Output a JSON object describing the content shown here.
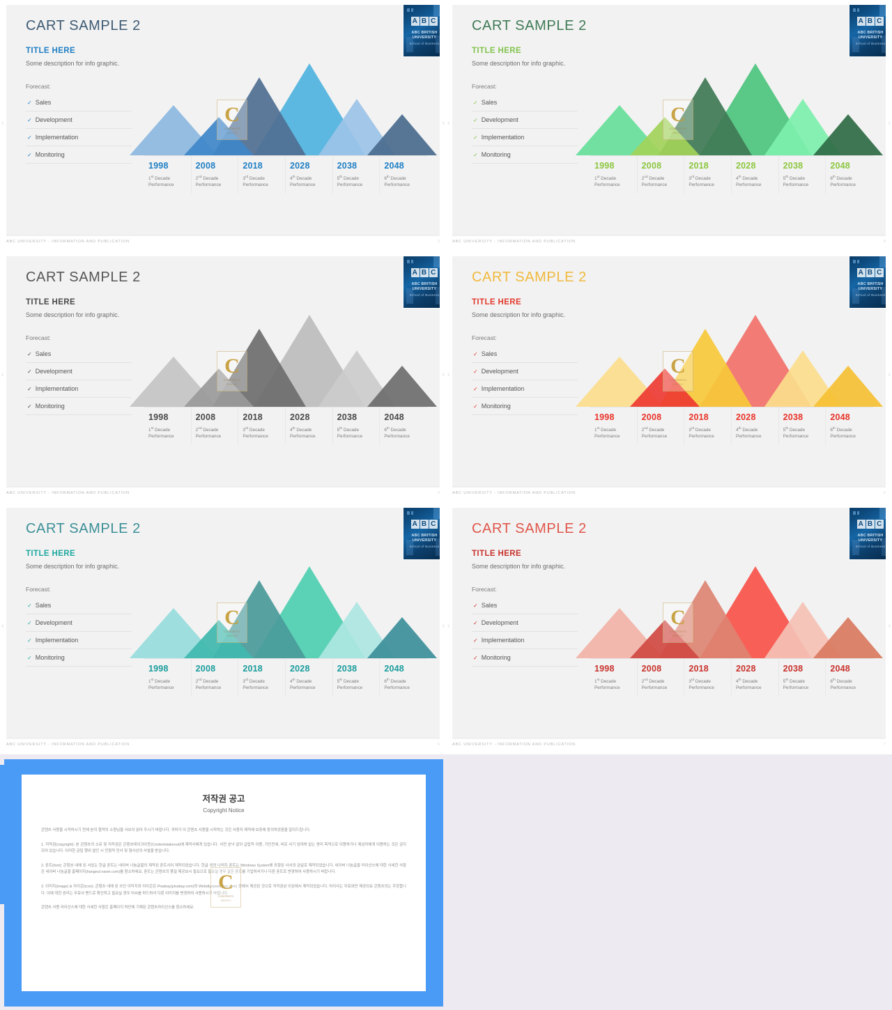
{
  "deck": {
    "slide_title": "CART SAMPLE 2",
    "info_title": "TITLE HERE",
    "info_desc": "Some description for info graphic.",
    "forecast_label": "Forecast:",
    "checklist": [
      "Sales",
      "Development",
      "Implementation",
      "Monitoring"
    ],
    "tick_glyph": "✓",
    "nav_prev": "‹",
    "nav_next": "›",
    "footer_text": "ABC UNIVERSITY - INFORMATION AND PUBLICATION"
  },
  "logo": {
    "abc_letters": [
      "A",
      "B",
      "C"
    ],
    "name_line1": "ABC BRITISH",
    "name_line2": "UNIVERSITY",
    "subtitle": "School of Business"
  },
  "watermark": {
    "letter": "C",
    "line1": "CONTENTS",
    "line2": "TAKEOUT"
  },
  "chart_data": {
    "type": "area",
    "title": "CART SAMPLE 2",
    "subtitle": "TITLE HERE",
    "xlabel": "",
    "ylabel": "",
    "grid": false,
    "legend": "none",
    "categories": [
      "1998",
      "2008",
      "2018",
      "2028",
      "2038",
      "2048"
    ],
    "tick_sublabels": [
      {
        "ordinal": "1",
        "suffix": "st",
        "text": "Decade Performance"
      },
      {
        "ordinal": "2",
        "suffix": "nd",
        "text": "Decade Performance"
      },
      {
        "ordinal": "3",
        "suffix": "rd",
        "text": "Decade Performance"
      },
      {
        "ordinal": "4",
        "suffix": "th",
        "text": "Decade Performance"
      },
      {
        "ordinal": "5",
        "suffix": "th",
        "text": "Decade Performance"
      },
      {
        "ordinal": "6",
        "suffix": "th",
        "text": "Decade Performance"
      }
    ],
    "values": [
      55,
      42,
      85,
      100,
      62,
      45
    ],
    "ylim": [
      0,
      100
    ],
    "note": "Six overlapping triangular peaks, relative peak heights as percent of plot height."
  },
  "peaks": [
    {
      "center_pct": 10,
      "half_width_pct": 15,
      "height_pct": 55,
      "z": 2
    },
    {
      "center_pct": 25.5,
      "half_width_pct": 12,
      "height_pct": 42,
      "z": 3
    },
    {
      "center_pct": 39,
      "half_width_pct": 16,
      "height_pct": 85,
      "z": 2
    },
    {
      "center_pct": 56,
      "half_width_pct": 19,
      "height_pct": 100,
      "z": 1
    },
    {
      "center_pct": 72,
      "half_width_pct": 13,
      "height_pct": 62,
      "z": 2
    },
    {
      "center_pct": 87.5,
      "half_width_pct": 12,
      "height_pct": 45,
      "z": 3
    }
  ],
  "slides": [
    {
      "page": "3",
      "theme": "blue",
      "title_color": "#3d5a73",
      "subtitle_color": "#1f7fc4",
      "year_color": "#1f7fc4",
      "check_color": "#555555",
      "peak_colors": [
        "#8cb8e0",
        "#3f87c9",
        "#4f6f92",
        "#4fb3de",
        "#9cc3e8",
        "#4a6b8e"
      ]
    },
    {
      "page": "8",
      "theme": "green",
      "title_color": "#3f7a55",
      "subtitle_color": "#82c44d",
      "year_color": "#8cc63f",
      "check_color": "#555555",
      "peak_colors": [
        "#66de9a",
        "#a2d25a",
        "#3f7a55",
        "#4dc47e",
        "#7df0ad",
        "#2f6b45"
      ]
    },
    {
      "page": "4",
      "theme": "gray",
      "title_color": "#555555",
      "subtitle_color": "#4a4a4a",
      "year_color": "#4a4a4a",
      "check_color": "#555555",
      "peak_colors": [
        "#c4c4c4",
        "#9a9a9a",
        "#6e6e6e",
        "#bdbdbd",
        "#cccccc",
        "#6e6e6e"
      ]
    },
    {
      "page": "5",
      "theme": "yellow",
      "title_color": "#f0b93c",
      "subtitle_color": "#e23b2e",
      "year_color": "#e8342a",
      "check_color": "#555555",
      "peak_colors": [
        "#fbdd8c",
        "#ee3b33",
        "#f7c93a",
        "#f2726a",
        "#fbdd8c",
        "#f5c033"
      ]
    },
    {
      "page": "6",
      "theme": "teal",
      "title_color": "#3b8f97",
      "subtitle_color": "#1fa8a0",
      "year_color": "#1a9c9c",
      "check_color": "#555555",
      "peak_colors": [
        "#97dcdc",
        "#3fb9ae",
        "#4a9a9a",
        "#4ecfb0",
        "#aee6e3",
        "#3d8f9a"
      ]
    },
    {
      "page": "7",
      "theme": "red",
      "title_color": "#e0564a",
      "subtitle_color": "#c8322c",
      "year_color": "#c8322c",
      "check_color": "#555555",
      "peak_colors": [
        "#f2b3a8",
        "#d04a42",
        "#dd8472",
        "#f8534a",
        "#f5c1b5",
        "#d9795f"
      ]
    }
  ],
  "copyright": {
    "title": "저작권 공고",
    "subtitle": "Copyright Notice",
    "paragraphs": [
      "콘텐츠 사용을 시작하시기 전에 본의 협약의 소원님을 사보이 읽어 주시기 바랍니다. 귀하가 이 콘텐츠 사용을 시작하는 것은 사용자 제약에 보증에 동의하셨음을 알려드립니다.",
      "1. 저작권(copyright): 본 콘텐츠의 소유 및 저작권은 콘텐츠테이크아웃(Contentstakeout)에 제작사에게 있습니다. 사전 승낙 없이 급립적 이용, 가인전세, 비로 사기 임대하 없는 영리 목적으로 이용하거나 제삼자에게 이용하는 것은 금지되어 있습니다. 이러한 금립 행위 발인 시 민형적 민사 및 형사상의 사벌을 받습니다.",
      "2. 폰트(font): 콘텐츠 내에 된 서있는 한글 폰트는 네이버 나눔글꼴의 제작된 폰트사이 제작되었습니다. 한글 외의 나머지 폰트는 Windows System에 포함된 사서의 금살로 제작되었습니다. 네이버 나눔글꼴 라이선스에 대한 사세한 사항은 네이버 나눔글꼴 홈페이지(hangeul.naver.com)를 참소하세요. 폰트는 콘텐츠의 품질 제공보시 필요으로 필요실 경우 같은 폰트를 기업하셔거나 다른 폰트로 변경하여 사용하시기 바랍니다.",
      "3. 이미지(image) & 아이콘(icon): 콘텐츠 내에 된 쓰인 이미지와 아이콘은 Pixabay(pixabay.com)와 Webdlys(webdlys.com) 중에서 제공된 것으로 저작권삼 이상에서 제작되었습니다. 아이사는 무료와만 제공되요 콘텐츠의는 주장합니다. 이에 대한 권리는 무료사 밴드로 확인하고 필요실 경우 어씨를 하드하셔 다른 이미지를 변경하여 사용하시기 바랍니다.",
      "콘텐츠 사용 라이선스에 대한 사세한 사항은 홈페이지 하단에 기제된 콘텐츠라이선스를 참소하세요."
    ]
  }
}
